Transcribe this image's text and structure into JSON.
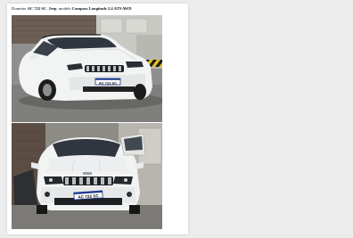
{
  "document": {
    "caption_prefix": "Dominio ",
    "plate_bold": "AC 722 SC",
    "caption_mid_1": ", ",
    "brand_bold": "Jeep",
    "caption_mid_2": ", modelo ",
    "model_bold": "Compass Longitude 2.4 AT9 AWD"
  },
  "photos": [
    {
      "plate_text": "AC 722 SC"
    },
    {
      "plate_text": "AC 722 SC"
    }
  ],
  "colors": {
    "viewer_bg": "#ececec",
    "page_bg": "#ffffff",
    "car_white": "#f2f3f3",
    "grille": "#1d1f22",
    "plate_blue": "#1e3d8f"
  }
}
